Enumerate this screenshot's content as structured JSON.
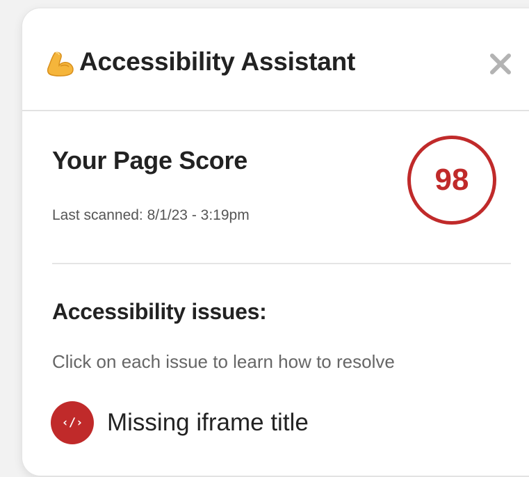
{
  "header": {
    "title": "Accessibility Assistant",
    "emoji_icon": "flexed-biceps-icon",
    "close_icon": "close-icon"
  },
  "score": {
    "heading": "Your Page Score",
    "last_scanned": "Last scanned: 8/1/23 - 3:19pm",
    "value": "98",
    "color": "#c02a2a"
  },
  "issues": {
    "heading": "Accessibility issues:",
    "help_text": "Click on each issue to learn how to resolve",
    "items": [
      {
        "icon": "code-icon",
        "icon_glyph": "‹/›",
        "label": "Missing iframe title"
      }
    ]
  }
}
